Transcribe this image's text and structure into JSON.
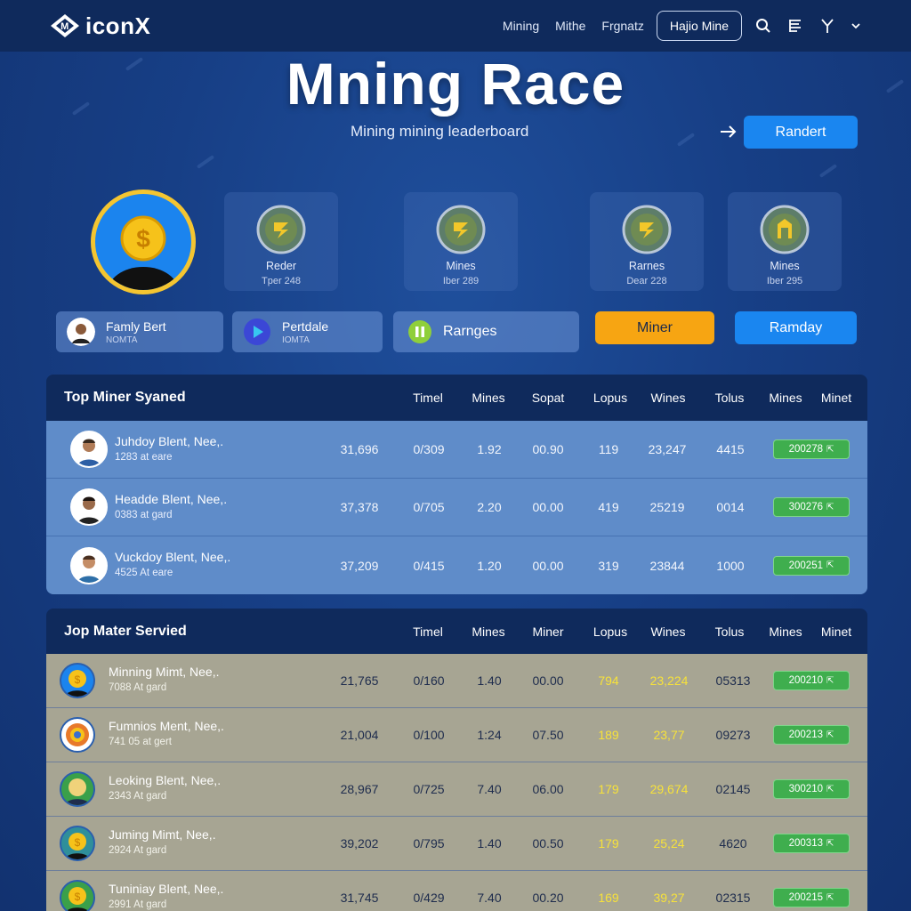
{
  "nav": {
    "logo_text": "iconX",
    "links": [
      "Mining",
      "Mithe",
      "Frgnatz"
    ],
    "button_label": "Hajio Mine",
    "icons": [
      "search-icon",
      "list-icon",
      "filter-icon",
      "chevron-down-icon"
    ]
  },
  "hero": {
    "title": "Mning Race",
    "subtitle": "Mining mining leaderboard",
    "cta_label": "Randert"
  },
  "stats": [
    {
      "label": "Reder",
      "value": "Tper 248"
    },
    {
      "label": "Mines",
      "value": "Iber 289"
    },
    {
      "label": "Rarnes",
      "value": "Dear 228"
    },
    {
      "label": "Mines",
      "value": "Iber 295"
    }
  ],
  "chips": [
    {
      "title": "Famly Bert",
      "sub": "NOMTA"
    },
    {
      "title": "Pertdale",
      "sub": "IOMTA"
    },
    {
      "title": "Rarnges",
      "sub": ""
    },
    {
      "title": "Miner",
      "sub": ""
    },
    {
      "title": "Ramday",
      "sub": ""
    }
  ],
  "table1": {
    "title": "Top Miner Syaned",
    "columns": [
      "Timel",
      "Mines",
      "Sopat",
      "Lopus",
      "Wines",
      "Tolus",
      "Mines",
      "Minet"
    ],
    "rows": [
      {
        "name": "Juhdoy Blent, Nee,.",
        "sub": "1283 at eare",
        "cells": [
          "31,696",
          "0/309",
          "1.92",
          "00.90",
          "119",
          "23,247",
          "4415"
        ],
        "pill": "200278"
      },
      {
        "name": "Headde Blent, Nee,.",
        "sub": "0383 at gard",
        "cells": [
          "37,378",
          "0/705",
          "2.20",
          "00.00",
          "419",
          "25219",
          "0014"
        ],
        "pill": "300276"
      },
      {
        "name": "Vuckdoy Blent, Nee,.",
        "sub": "4525 At eare",
        "cells": [
          "37,209",
          "0/415",
          "1.20",
          "00.00",
          "319",
          "23844",
          "1000"
        ],
        "pill": "200251"
      }
    ]
  },
  "table2": {
    "title": "Jop Mater Servied",
    "columns": [
      "Timel",
      "Mines",
      "Miner",
      "Lopus",
      "Wines",
      "Tolus",
      "Mines",
      "Minet"
    ],
    "rows": [
      {
        "name": "Minning Mimt, Nee,.",
        "sub": "7088 At gard",
        "cells": [
          "21,765",
          "0/160",
          "1.40",
          "00.00",
          "794",
          "23,224",
          "05313"
        ],
        "pill": "200210"
      },
      {
        "name": "Fumnios Ment, Nee,.",
        "sub": "741 05 at gert",
        "cells": [
          "21,004",
          "0/100",
          "1:24",
          "07.50",
          "189",
          "23,77",
          "09273"
        ],
        "pill": "200213"
      },
      {
        "name": "Leoking Blent, Nee,.",
        "sub": "2343 At gard",
        "cells": [
          "28,967",
          "0/725",
          "7.40",
          "06.00",
          "179",
          "29,674",
          "02145"
        ],
        "pill": "300210"
      },
      {
        "name": "Juming Mimt, Nee,.",
        "sub": "2924 At gard",
        "cells": [
          "39,202",
          "0/795",
          "1.40",
          "00.50",
          "179",
          "25,24",
          "4620"
        ],
        "pill": "200313"
      },
      {
        "name": "Tuniniay Blent, Nee,.",
        "sub": "2991 At gard",
        "cells": [
          "31,745",
          "0/429",
          "7.40",
          "00.20",
          "169",
          "39,27",
          "02315"
        ],
        "pill": "200215"
      }
    ]
  }
}
